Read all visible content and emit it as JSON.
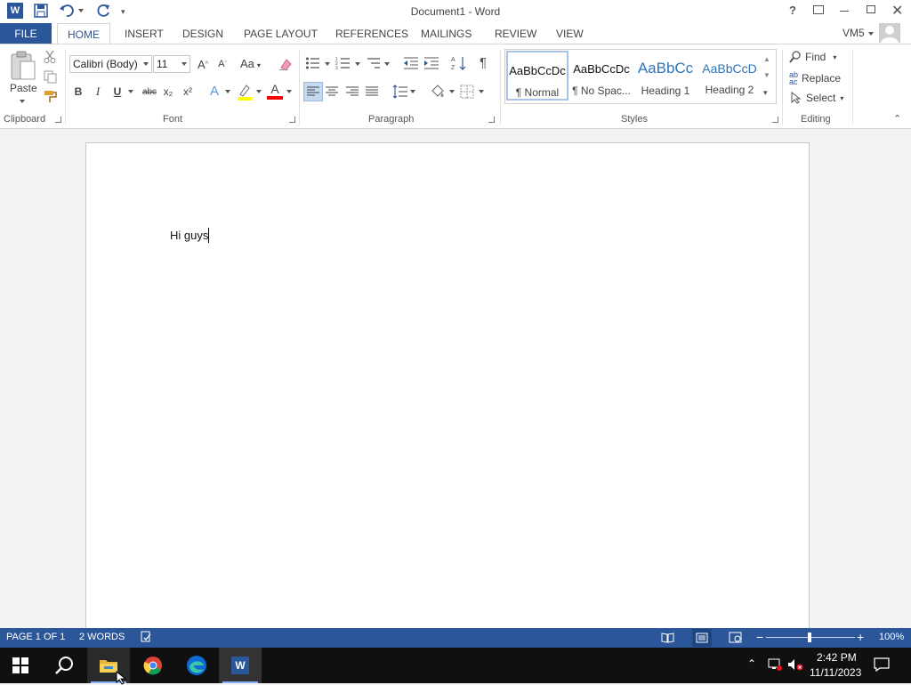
{
  "titlebar": {
    "title": "Document1 - Word",
    "help": "?"
  },
  "tabs": [
    {
      "label": "FILE"
    },
    {
      "label": "HOME"
    },
    {
      "label": "INSERT"
    },
    {
      "label": "DESIGN"
    },
    {
      "label": "PAGE LAYOUT"
    },
    {
      "label": "REFERENCES"
    },
    {
      "label": "MAILINGS"
    },
    {
      "label": "REVIEW"
    },
    {
      "label": "VIEW"
    }
  ],
  "user": {
    "name": "VM5"
  },
  "ribbon": {
    "clipboard": {
      "paste_label": "Paste",
      "group_label": "Clipboard"
    },
    "font": {
      "font_name": "Calibri (Body)",
      "font_size": "11",
      "change_case": "Aa",
      "bold": "B",
      "italic": "I",
      "underline": "U",
      "strikethrough": "abc",
      "subscript": "x₂",
      "superscript": "x²",
      "group_label": "Font"
    },
    "paragraph": {
      "group_label": "Paragraph"
    },
    "styles": {
      "items": [
        {
          "preview": "AaBbCcDc",
          "name": "¶ Normal"
        },
        {
          "preview": "AaBbCcDc",
          "name": "¶ No Spac..."
        },
        {
          "preview": "AaBbCc",
          "name": "Heading 1"
        },
        {
          "preview": "AaBbCcD",
          "name": "Heading 2"
        }
      ],
      "group_label": "Styles"
    },
    "editing": {
      "find": "Find",
      "replace": "Replace",
      "select": "Select",
      "group_label": "Editing"
    }
  },
  "document": {
    "text": "Hi guys"
  },
  "statusbar": {
    "page": "PAGE 1 OF 1",
    "words": "2 WORDS",
    "zoom": "100%"
  },
  "taskbar": {
    "time": "2:42 PM",
    "date": "11/11/2023"
  },
  "colors": {
    "accent": "#2b579a",
    "highlight": "#ffff00",
    "font_color": "#ff0000"
  }
}
